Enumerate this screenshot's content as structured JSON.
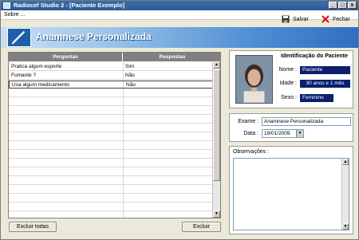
{
  "window": {
    "title": "Radiocef Studio 2 - [Paciente Exemplo]",
    "minimize": "_",
    "maximize": "□",
    "close": "x"
  },
  "menu": {
    "about": "Sobre ..."
  },
  "toolbar": {
    "save_label": "Salvar",
    "close_label": "Fechar"
  },
  "header": {
    "title": "Anamnese Personalizada"
  },
  "grid": {
    "headers": [
      "Perguntas",
      "Respostas"
    ],
    "rows": [
      {
        "question": "Pratica algum esporte",
        "answer": "Sim"
      },
      {
        "question": "Fumante ?",
        "answer": "Não"
      },
      {
        "question": "Usa algum medicamento",
        "answer": "Não"
      }
    ],
    "scroll_up": "▲",
    "scroll_down": "▼"
  },
  "buttons": {
    "delete_all": "Excluir todas",
    "delete": "Excluir"
  },
  "patient": {
    "section_title": "Identificação do Paciente",
    "name_label": "Nome :",
    "name_value": "Paciente",
    "age_label": "Idade :",
    "age_value": "30 anos e 1 mês",
    "sex_label": "Sexo :",
    "sex_value": "Feminino"
  },
  "exam": {
    "exam_label": "Exame :",
    "exam_value": "Anamnese Personalizada",
    "date_label": "Data :",
    "date_value": "19/01/2009",
    "date_dropdown": "▼"
  },
  "observations": {
    "label": "Observações :",
    "scroll_up": "▲",
    "scroll_down": "▼"
  }
}
